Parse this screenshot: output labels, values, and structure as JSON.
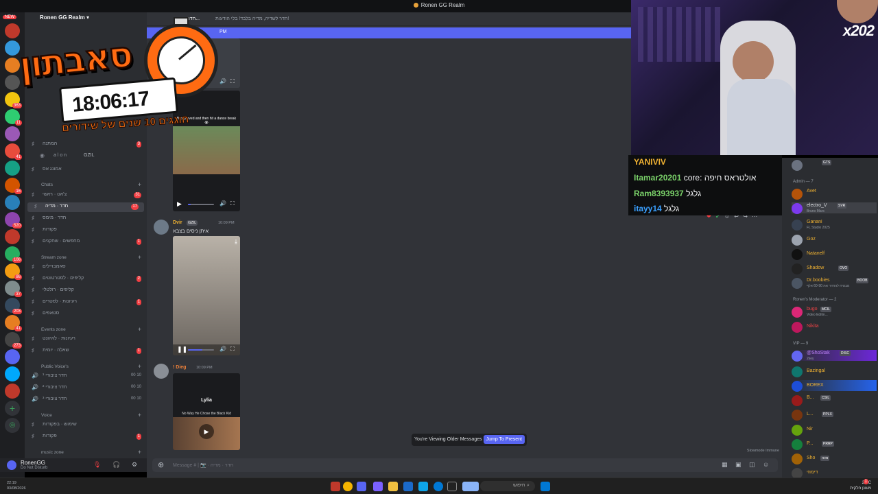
{
  "window": {
    "title": "Ronen GG Realm"
  },
  "server": {
    "name": "Ronen GG Realm",
    "new_tag": "NEW",
    "badges": [
      "363",
      "11",
      "41",
      "16",
      "520",
      "106",
      "86",
      "37",
      "203",
      "41",
      "273"
    ]
  },
  "channel_header": {
    "name": "חדר · מ...",
    "topic": "חדר לשדיה, מדיה בלבד! בלי הודעות!"
  },
  "new_messages_bar": "PM",
  "sidebar": {
    "top_channels": [
      {
        "label": "המתנה",
        "count": "3"
      },
      {
        "label": "a l o n",
        "tag": "GZIL"
      },
      {
        "label": "אמונג אס"
      }
    ],
    "categories": {
      "chats": "Chats",
      "stream_zone": "Stream zone",
      "events_zone": "Events zone",
      "public_voice": "Public Voice's",
      "voice": "Voice",
      "music_zone": "music zone"
    },
    "chat_channels": [
      {
        "label": "צ'אט · ראשי",
        "count": "31"
      },
      {
        "label": "חדר · מדיה",
        "count": "17"
      },
      {
        "label": "חדר · מימס"
      },
      {
        "label": "פקודות"
      },
      {
        "label": "מחפשים · שחקנים",
        "count": "1"
      }
    ],
    "stream_channels": [
      {
        "label": "סאמבויילים"
      },
      {
        "label": "קליפים · לסטרטוטים",
        "count": "2"
      },
      {
        "label": "קליפים · רולטלי"
      },
      {
        "label": "רעיונות · לסטרים",
        "count": "1"
      },
      {
        "label": "סטאפים"
      }
    ],
    "event_channels": [
      {
        "label": "רעיונות · לאיוונט"
      },
      {
        "label": "שאלה · יומית",
        "count": "1"
      }
    ],
    "public_voice_channels": [
      {
        "label": "חדר ציבורי ¹",
        "users": "00",
        "limit": "10"
      },
      {
        "label": "חדר ציבורי ²",
        "users": "00",
        "limit": "10"
      },
      {
        "label": "חדר ציבורי ³",
        "users": "00",
        "limit": "10"
      }
    ],
    "voice_channels": [
      {
        "label": "שימוש · בפקודות",
        "count": ""
      },
      {
        "label": "פקודות",
        "count": "1"
      }
    ]
  },
  "user_panel": {
    "name": "RonenGG",
    "status": "Do Not Disturb"
  },
  "messages": [
    {
      "video_caption": "Bro grieved and then hit a dance break 😭"
    },
    {
      "author": "Dvir",
      "tag": "GZIL",
      "time": "10:09 PM",
      "text": "איתן ניסים בצבא"
    },
    {
      "author": "! Dieg",
      "time": "10:09 PM",
      "video_title": "Lylia",
      "video_caption": "No Way He Chose the Black Kid"
    }
  ],
  "older_notice": {
    "text": "You're Viewing Older Messages",
    "button": "Jump To Present"
  },
  "composer": {
    "placeholder": "Message # | 📷 · חדר · מדיה"
  },
  "slowmode": "Slowmode Immune",
  "members": {
    "top": {
      "tag": "GTS"
    },
    "groups": {
      "admin": "Admin — 7",
      "moderator": "Ronen's Moderator — 2",
      "vip": "VIP — 9"
    },
    "admin": [
      {
        "name": "Avet",
        "color": "#f0b232"
      },
      {
        "name": "electro_V",
        "tag": "SVR",
        "sub": "Bruno Mars",
        "color": "#dbdee1"
      },
      {
        "name": "Ganani",
        "sub": "FL Studio 2025",
        "color": "#f0b232"
      },
      {
        "name": "Goz",
        "color": "#f0b232"
      },
      {
        "name": "Natanelf",
        "color": "#f0b232"
      },
      {
        "name": "Shadow",
        "tag": "OVO",
        "color": "#f0b232"
      },
      {
        "name": "Dr.boobies",
        "tag": "BOOB",
        "sub": "מבטיח להחזיר את 60-90 אלף",
        "color": "#f0b232"
      }
    ],
    "moderator": [
      {
        "name": "bugo",
        "tag": "MCIL",
        "sub": "Video Editin...",
        "color": "#ed4245"
      },
      {
        "name": "Nikita",
        "color": "#ed4245"
      }
    ],
    "vip": [
      {
        "name": "@ShoStak",
        "tag": "DISC",
        "sub": "2key",
        "color": "#c084fc"
      },
      {
        "name": "Bazingal",
        "color": "#f0b232"
      },
      {
        "name": "BOREX",
        "color": "#f0b232"
      },
      {
        "name": "B...",
        "tag": "CSIL",
        "color": "#f0b232"
      },
      {
        "name": "L...",
        "tag": "PPLX",
        "color": "#f0b232"
      },
      {
        "name": "Nir",
        "color": "#f0b232"
      },
      {
        "name": "P...",
        "tag": "PRRP",
        "color": "#f0b232"
      },
      {
        "name": "Sho",
        "tag": "נזכה",
        "color": "#f0b232"
      },
      {
        "name": "דימוזי",
        "color": "#f0b232"
      }
    ]
  },
  "stream_overlay": {
    "title_he": "סאבתון",
    "timer": "18:06:17",
    "subtitle_he": "חוגגים 10 שנים של שידורים",
    "cam_tag": "x202",
    "chat": [
      {
        "user": "YANIVIV",
        "text": "",
        "color": "#f0b232"
      },
      {
        "user": "Itamar20201",
        "text": "core: אולטראס חיפה",
        "color": "#7bd36a"
      },
      {
        "user": "Ram8393937",
        "text": "גלגל",
        "color": "#7bd36a"
      },
      {
        "user": "itayy14",
        "text": "גלגל",
        "color": "#3aa0ff"
      }
    ]
  },
  "taskbar": {
    "search": "חיפוש",
    "left_time": "22:19",
    "left_date": "03/08/2026",
    "weather": "29°C",
    "weather_text": "מעונן חלקית",
    "count": "1"
  }
}
